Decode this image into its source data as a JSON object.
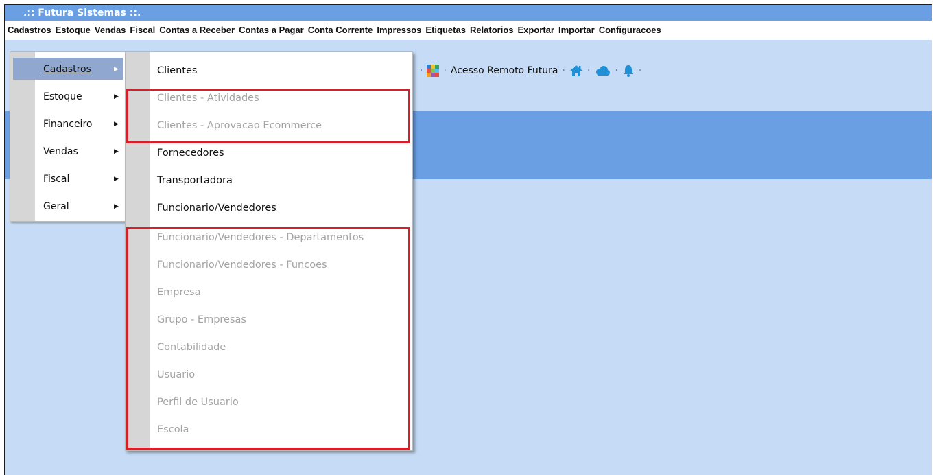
{
  "window": {
    "title": ".:: Futura Sistemas ::."
  },
  "menubar": {
    "items": [
      "Cadastros",
      "Estoque",
      "Vendas",
      "Fiscal",
      "Contas a Receber",
      "Contas a Pagar",
      "Conta Corrente",
      "Impressos",
      "Etiquetas",
      "Relatorios",
      "Exportar",
      "Importar",
      "Configuracoes"
    ]
  },
  "toolbar": {
    "remote_access_label": "Acesso Remoto Futura",
    "icons": [
      "color-grid-icon",
      "home-icon",
      "cloud-icon",
      "bell-icon"
    ]
  },
  "menu_main": {
    "items": [
      {
        "label": "Cadastros",
        "selected": true
      },
      {
        "label": "Estoque"
      },
      {
        "label": "Financeiro"
      },
      {
        "label": "Vendas"
      },
      {
        "label": "Fiscal"
      },
      {
        "label": "Geral"
      }
    ],
    "arrow": "▶"
  },
  "menu_sub": {
    "items": [
      {
        "label": "Clientes",
        "enabled": true
      },
      {
        "label": "Clientes - Atividades",
        "enabled": false
      },
      {
        "label": "Clientes - Aprovacao Ecommerce",
        "enabled": false
      },
      {
        "label": "Fornecedores",
        "enabled": true
      },
      {
        "label": "Transportadora",
        "enabled": true
      },
      {
        "label": "Funcionario/Vendedores",
        "enabled": true
      },
      {
        "label": "Funcionario/Vendedores - Departamentos",
        "enabled": false
      },
      {
        "label": "Funcionario/Vendedores - Funcoes",
        "enabled": false
      },
      {
        "label": "Empresa",
        "enabled": false
      },
      {
        "label": "Grupo - Empresas",
        "enabled": false
      },
      {
        "label": "Contabilidade",
        "enabled": false
      },
      {
        "label": "Usuario",
        "enabled": false
      },
      {
        "label": "Perfil de Usuario",
        "enabled": false
      },
      {
        "label": "Escola",
        "enabled": false
      }
    ]
  },
  "colors": {
    "titlebar": "#6a9fe4",
    "background": "#c6dbf5",
    "highlight_box": "#d5202a",
    "selected_item": "#90a8cf",
    "disabled_text": "#a4a4a4",
    "icon_blue": "#1f8fd6"
  }
}
